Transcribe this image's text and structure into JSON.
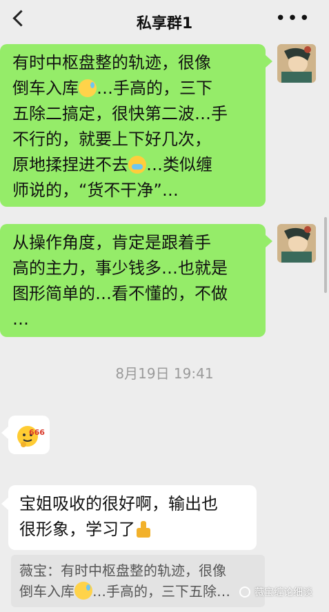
{
  "header": {
    "title": "私享群1",
    "more_label": "•••"
  },
  "messages": [
    {
      "side": "right",
      "lines": [
        "有时中枢盘整的轨迹，很像",
        "倒车入库[sweat]…手高的，三下",
        "五除二搞定，很快第二波…手",
        "不行的，就要上下好几次，",
        "原地揉捏进不去[cry]…类似缠",
        "师说的，“货不干净”…"
      ]
    },
    {
      "side": "right",
      "lines": [
        "从操作角度，肯定是跟着手",
        "高的主力，事少钱多…也就是",
        "图形简单的…看不懂的，不做",
        "…"
      ]
    }
  ],
  "timestamp": "8月19日 19:41",
  "sticker_text": "666",
  "reply": {
    "lines": [
      "宝姐吸收的很好啊，输出也",
      "很形象，学习了[thumb]"
    ],
    "quote_lines": [
      "薇宝：有时中枢盘整的轨迹，很像",
      "倒车入库[sweat]…手高的，三下五除…"
    ]
  },
  "watermark": "薇宝缠论细谈",
  "colors": {
    "my_bubble": "#95ec69",
    "other_bubble": "#ffffff",
    "background": "#ededed"
  },
  "icons": [
    "back-arrow-icon",
    "more-icon",
    "sweat-smile-emoji",
    "cry-laugh-emoji",
    "thumbs-up-emoji",
    "watermark-icon"
  ]
}
